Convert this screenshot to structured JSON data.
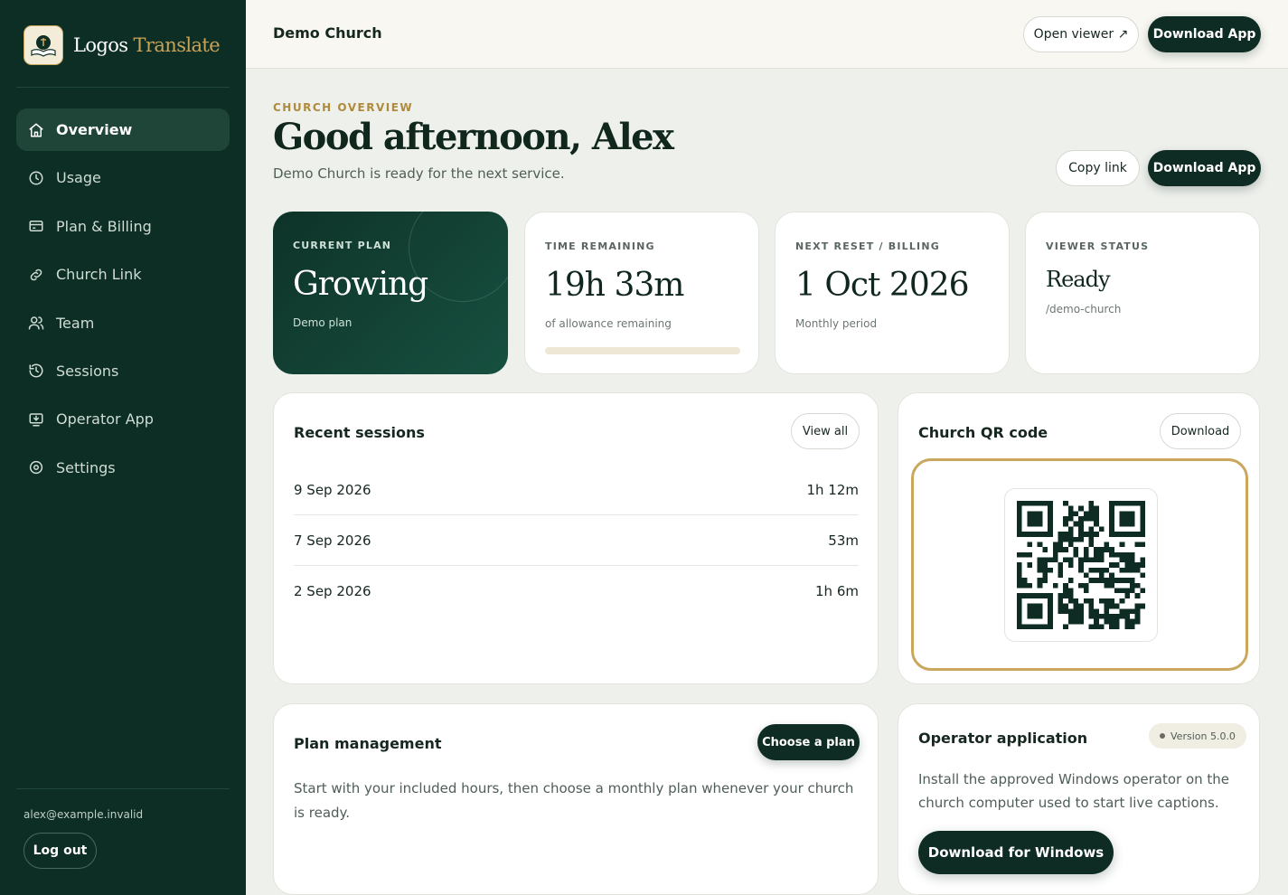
{
  "brand": {
    "name_primary": "Logos",
    "name_accent": "Translate",
    "logo_icon": "bible-icon"
  },
  "sidebar": {
    "items": [
      {
        "label": "Overview",
        "icon": "home-icon",
        "active": true
      },
      {
        "label": "Usage",
        "icon": "clock-icon"
      },
      {
        "label": "Plan & Billing",
        "icon": "credit-card-icon"
      },
      {
        "label": "Church Link",
        "icon": "link-icon"
      },
      {
        "label": "Team",
        "icon": "users-icon"
      },
      {
        "label": "Sessions",
        "icon": "history-icon"
      },
      {
        "label": "Operator App",
        "icon": "download-monitor-icon"
      },
      {
        "label": "Settings",
        "icon": "gear-icon"
      }
    ],
    "email": "alex@example.invalid",
    "logout_label": "Log out"
  },
  "topbar": {
    "title": "Demo Church",
    "open_viewer_label": "Open viewer ↗",
    "download_app_label": "Download App"
  },
  "header": {
    "eyebrow": "CHURCH OVERVIEW",
    "greeting": "Good afternoon, Alex",
    "subline": "Demo Church is ready for the next service.",
    "copy_link_label": "Copy link",
    "download_app_label": "Download App"
  },
  "stats": {
    "plan": {
      "label": "CURRENT PLAN",
      "value": "Growing",
      "sub": "Demo plan"
    },
    "time": {
      "label": "TIME REMAINING",
      "value": "19h 33m",
      "sub": "of allowance remaining",
      "progress_percent": 0
    },
    "reset": {
      "label": "NEXT RESET / BILLING",
      "value": "1 Oct 2026",
      "sub": "Monthly period"
    },
    "viewer": {
      "label": "VIEWER STATUS",
      "value": "Ready",
      "sub": "/demo-church"
    }
  },
  "recent_sessions": {
    "title": "Recent sessions",
    "view_all_label": "View all",
    "rows": [
      {
        "date": "9 Sep 2026",
        "duration": "1h 12m"
      },
      {
        "date": "7 Sep 2026",
        "duration": "53m"
      },
      {
        "date": "2 Sep 2026",
        "duration": "1h 6m"
      }
    ]
  },
  "qr": {
    "title": "Church QR code",
    "download_label": "Download",
    "qr_icon": "qr-code-icon"
  },
  "plan_management": {
    "title": "Plan management",
    "choose_label": "Choose a plan",
    "description": "Start with your included hours, then choose a monthly plan whenever your church is ready."
  },
  "operator": {
    "title": "Operator application",
    "version": "Version 5.0.0",
    "description": "Install the approved Windows operator on the church computer used to start live captions.",
    "download_label": "Download for Windows"
  },
  "colors": {
    "sidebar_bg": "#0d2e24",
    "accent_gold": "#c8a35a",
    "primary_dark": "#0e2c23",
    "page_bg": "#eef0ec"
  }
}
